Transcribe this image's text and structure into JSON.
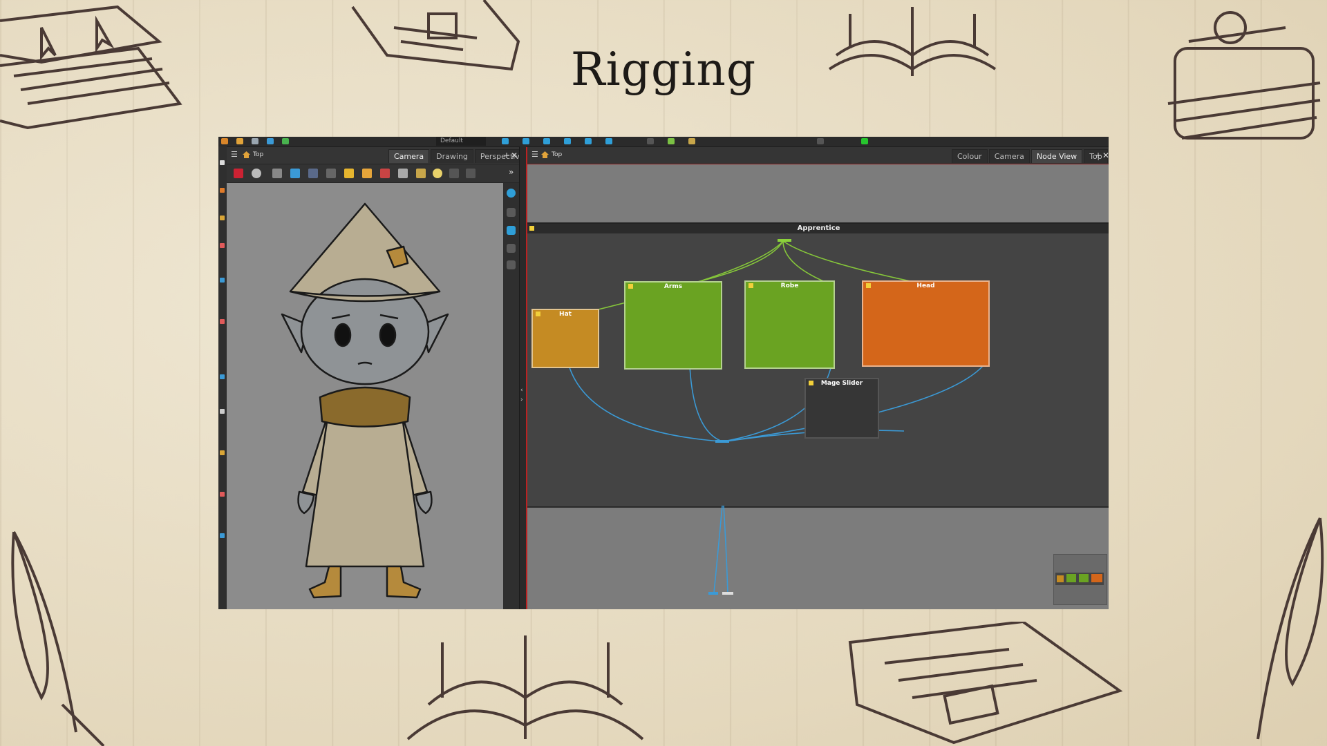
{
  "slide": {
    "title": "Rigging"
  },
  "toolbar": {
    "preset": "Default"
  },
  "camera_panel": {
    "breadcrumb": "Top",
    "tabs": [
      "Camera",
      "Drawing",
      "Perspective"
    ],
    "active_tab": "Camera"
  },
  "node_view_panel": {
    "breadcrumb": "Top",
    "tabs": [
      "Colour",
      "Camera",
      "Node View",
      "Top"
    ],
    "active_tab": "Node View",
    "group_title": "Apprentice",
    "nodes": [
      {
        "label": "Hat",
        "color": "#d69a2a"
      },
      {
        "label": "Arms",
        "color": "#6fae2a"
      },
      {
        "label": "Robe",
        "color": "#6fae2a"
      },
      {
        "label": "Head",
        "color": "#d9691e"
      },
      {
        "label": "Mage Slider",
        "color": "#3a3a3a"
      }
    ]
  },
  "colors": {
    "background": "#e9dfc8",
    "accent_green": "#7bd12c",
    "accent_orange": "#e06b1a",
    "accent_gold": "#e0a22e",
    "wire_blue": "#3b9ad6"
  }
}
